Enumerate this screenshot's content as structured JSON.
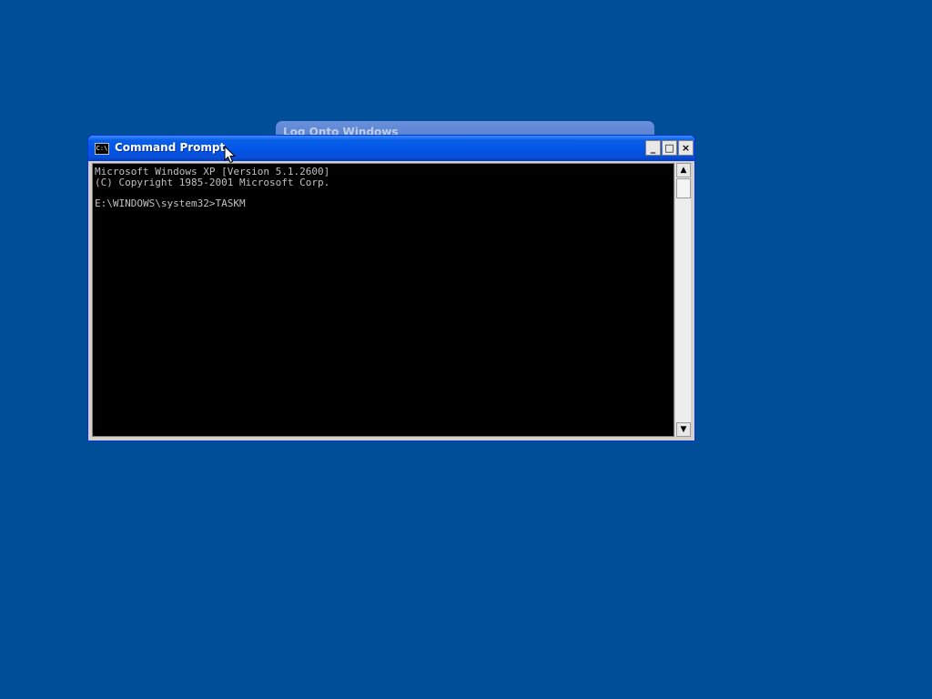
{
  "desktop": {
    "background_color": "#004e98",
    "background_window_title": "Log Onto Windows"
  },
  "window": {
    "title": "Command Prompt",
    "icon": "cmd-icon",
    "icon_text": "C:\\",
    "controls": {
      "minimize": "_",
      "maximize": "□",
      "close": "×"
    }
  },
  "console": {
    "lines": [
      "Microsoft Windows XP [Version 5.1.2600]",
      "(C) Copyright 1985-2001 Microsoft Corp.",
      "",
      "E:\\WINDOWS\\system32>TASKM"
    ]
  },
  "scrollbar": {
    "up_arrow": "▲",
    "down_arrow": "▼"
  }
}
